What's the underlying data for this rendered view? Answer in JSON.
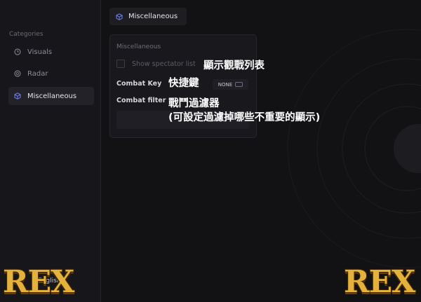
{
  "sidebar": {
    "heading": "Categories",
    "items": [
      {
        "label": "Visuals",
        "icon": "clock-icon",
        "active": false
      },
      {
        "label": "Radar",
        "icon": "radar-icon",
        "active": false
      },
      {
        "label": "Miscellaneous",
        "icon": "cube-icon",
        "active": true
      }
    ],
    "language": "English"
  },
  "tab": {
    "label": "Miscellaneous",
    "icon": "cube-icon"
  },
  "panel": {
    "title": "Miscellaneous",
    "spectator_label": "Show spectator list",
    "combat_key_label": "Combat Key",
    "combat_key_value": "NONE",
    "combat_filter_label": "Combat filter"
  },
  "annotations": {
    "spectator": "顯示觀戰列表",
    "combat_key": "快捷鍵",
    "combat_filter_1": "戰鬥過濾器",
    "combat_filter_2": "(可設定過濾掉哪些不重要的顯示)"
  },
  "logo": {
    "text": "REX"
  },
  "colors": {
    "accent": "#5568d8",
    "background": "#121215",
    "sidebar": "#17171b",
    "logo_gold": "#e4b23c"
  }
}
